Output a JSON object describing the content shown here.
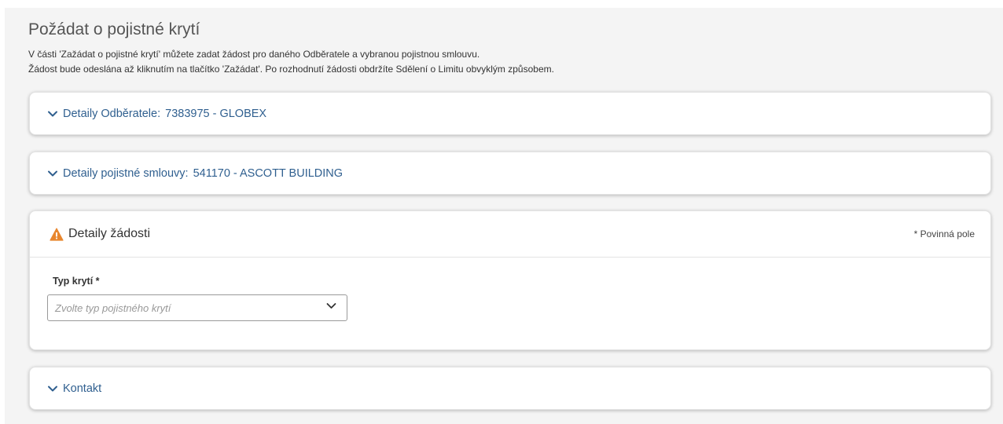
{
  "header": {
    "title": "Požádat o pojistné krytí",
    "intro_line1": "V části 'Zažádat o pojistné krytí' můžete zadat žádost pro daného Odběratele a vybranou pojistnou smlouvu.",
    "intro_line2": "Žádost bude odeslána až kliknutím na tlačítko 'Zažádat'. Po rozhodnutí žádosti obdržíte Sdělení o Limitu obvyklým způsobem."
  },
  "sections": {
    "buyer": {
      "label": "Detaily Odběratele:",
      "value": "7383975 - GLOBEX",
      "icon": "chevron-down-icon"
    },
    "policy": {
      "label": "Detaily pojistné smlouvy:",
      "value": "541170 - ASCOTT BUILDING",
      "icon": "chevron-down-icon"
    },
    "request": {
      "title": "Detaily žádosti",
      "icon": "warning-icon",
      "required_note": "* Povinná pole",
      "cover_type": {
        "label": "Typ krytí *",
        "placeholder": "Zvolte typ pojistného krytí"
      }
    },
    "contact": {
      "label": "Kontakt",
      "icon": "chevron-down-icon"
    }
  },
  "colors": {
    "accent": "#2f5f8f",
    "warning": "#e8862e",
    "background": "#f4f4f4"
  }
}
